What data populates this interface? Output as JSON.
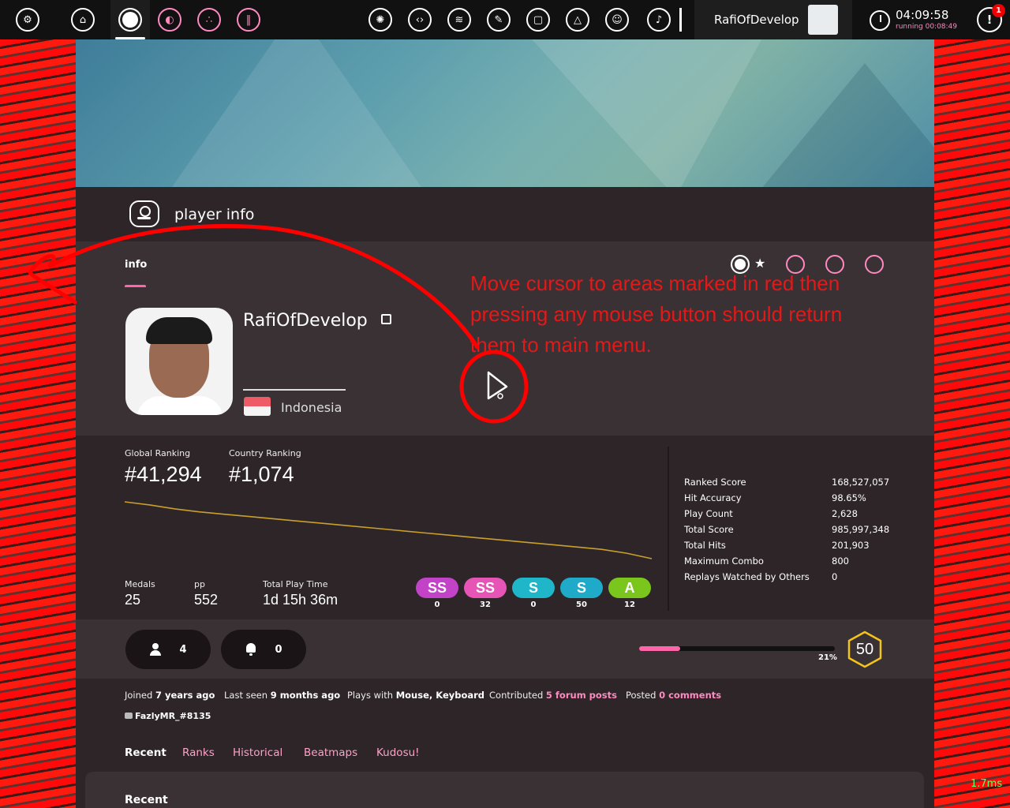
{
  "toolbar": {
    "username": "RafiOfDevelop",
    "clock_time": "04:09:58",
    "clock_running": "running 00:08:49",
    "notification_count": "1"
  },
  "header": {
    "title": "player info"
  },
  "info_tab": {
    "label": "info"
  },
  "profile": {
    "username": "RafiOfDevelop",
    "country": "Indonesia"
  },
  "annotation": {
    "text": "Move cursor to areas marked in red then pressing any mouse button should return them to main menu."
  },
  "stats": {
    "global_ranking_label": "Global Ranking",
    "global_ranking": "#41,294",
    "country_ranking_label": "Country Ranking",
    "country_ranking": "#1,074",
    "medals_label": "Medals",
    "medals": "25",
    "pp_label": "pp",
    "pp": "552",
    "playtime_label": "Total Play Time",
    "playtime": "1d 15h 36m",
    "rank_history": [
      636,
      640,
      645,
      649,
      652,
      655,
      658,
      661,
      664,
      667,
      670,
      673,
      676,
      679,
      682,
      685,
      688,
      691,
      694,
      697,
      702,
      709
    ],
    "grades": [
      {
        "label": "SS",
        "count": "0",
        "color": "#c343c8"
      },
      {
        "label": "SS",
        "count": "32",
        "color": "#e655b6"
      },
      {
        "label": "S",
        "count": "0",
        "color": "#1eb6c8"
      },
      {
        "label": "S",
        "count": "50",
        "color": "#1eaac8"
      },
      {
        "label": "A",
        "count": "12",
        "color": "#7bc61c"
      }
    ],
    "details": [
      {
        "label": "Ranked Score",
        "value": "168,527,057"
      },
      {
        "label": "Hit Accuracy",
        "value": "98.65%"
      },
      {
        "label": "Play Count",
        "value": "2,628"
      },
      {
        "label": "Total Score",
        "value": "985,997,348"
      },
      {
        "label": "Total Hits",
        "value": "201,903"
      },
      {
        "label": "Maximum Combo",
        "value": "800"
      },
      {
        "label": "Replays Watched by Others",
        "value": "0"
      }
    ]
  },
  "social": {
    "followers": "4",
    "subscriptions": "0"
  },
  "level": {
    "progress_label": "21%",
    "progress_fraction": 0.21,
    "level": "50"
  },
  "meta": {
    "joined_prefix": "Joined ",
    "joined": "7 years ago",
    "last_seen_prefix": "Last seen ",
    "last_seen": "9 months ago",
    "plays_with_prefix": "Plays with ",
    "plays_with": "Mouse, Keyboard",
    "contributed_prefix": "Contributed ",
    "contributed": "5 forum posts",
    "posted_prefix": "Posted ",
    "posted": "0 comments",
    "discord": "FazlyMR_#8135"
  },
  "tabs": [
    "Recent",
    "Ranks",
    "Historical",
    "Beatmaps",
    "Kudosu!"
  ],
  "recent_section": {
    "title": "Recent"
  },
  "overlay": {
    "latency": "1.7ms"
  },
  "colors": {
    "accent_pink": "#ff66aa",
    "annotation_red": "#e51818",
    "rank_line": "#c9a02b"
  }
}
